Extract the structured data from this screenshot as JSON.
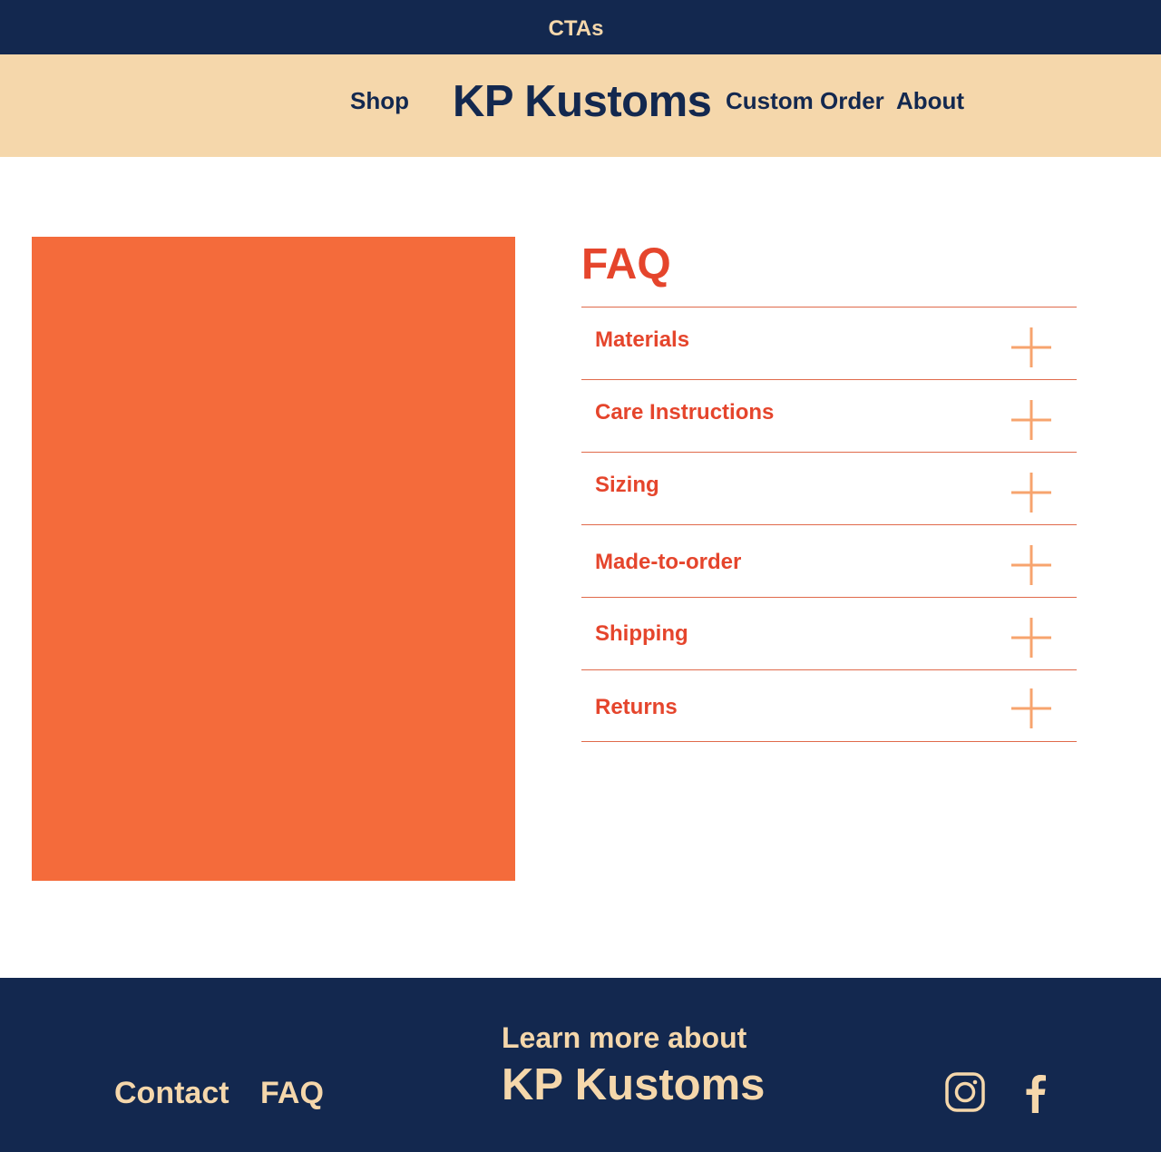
{
  "topbar": {
    "text": "CTAs"
  },
  "header": {
    "brand": "KP Kustoms",
    "nav": {
      "shop": "Shop",
      "custom_order": "Custom Order",
      "about": "About"
    }
  },
  "faq": {
    "title": "FAQ",
    "items": [
      {
        "label": "Materials",
        "icon": "plus-icon"
      },
      {
        "label": "Care Instructions",
        "icon": "plus-icon"
      },
      {
        "label": "Sizing",
        "icon": "plus-icon"
      },
      {
        "label": "Made-to-order",
        "icon": "plus-icon"
      },
      {
        "label": "Shipping",
        "icon": "plus-icon"
      },
      {
        "label": "Returns",
        "icon": "plus-icon"
      }
    ]
  },
  "footer": {
    "contact": "Contact",
    "faq": "FAQ",
    "learn_more": "Learn more about",
    "brand": "KP Kustoms",
    "social": [
      "instagram-icon",
      "facebook-icon"
    ]
  },
  "colors": {
    "navy": "#13284f",
    "cream": "#f5d7ab",
    "orange_block": "#f46b3b",
    "faq_red": "#e5452c",
    "plus_icon": "#f7a46e",
    "divider": "#e06a4b"
  }
}
